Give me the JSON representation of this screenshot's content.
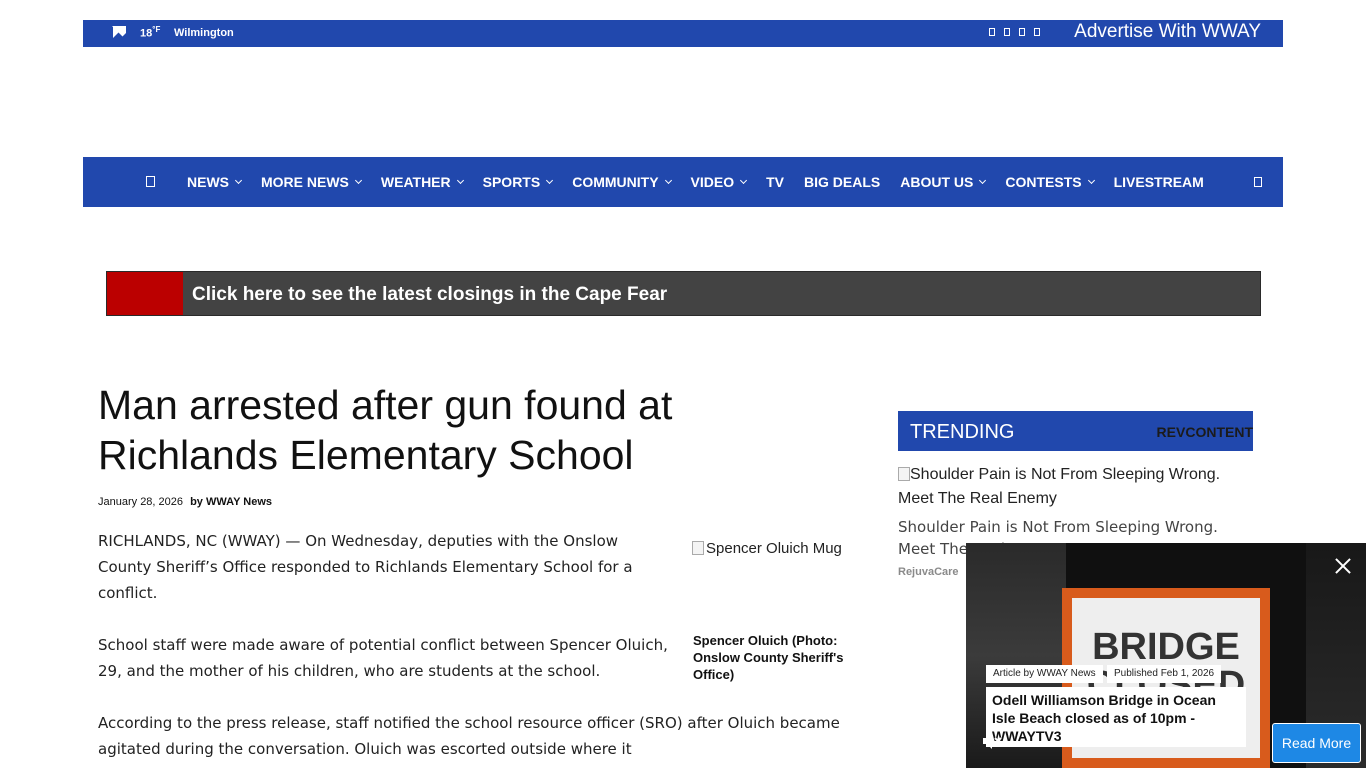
{
  "topbar": {
    "temperature": "18",
    "temp_unit": "°F",
    "city": "Wilmington",
    "advertise_label": "Advertise With WWAY",
    "social_icons": [
      "facebook-icon",
      "twitter-icon",
      "instagram-icon",
      "youtube-icon"
    ]
  },
  "nav": {
    "items": [
      {
        "label": "NEWS",
        "dropdown": true
      },
      {
        "label": "MORE NEWS",
        "dropdown": true
      },
      {
        "label": "WEATHER",
        "dropdown": true
      },
      {
        "label": "SPORTS",
        "dropdown": true
      },
      {
        "label": "COMMUNITY",
        "dropdown": true
      },
      {
        "label": "VIDEO",
        "dropdown": true
      },
      {
        "label": "TV",
        "dropdown": false
      },
      {
        "label": "BIG DEALS",
        "dropdown": false
      },
      {
        "label": "ABOUT US",
        "dropdown": true
      },
      {
        "label": "CONTESTS",
        "dropdown": true
      },
      {
        "label": "LIVESTREAM",
        "dropdown": false
      }
    ]
  },
  "closings": {
    "text": "Click here to see the latest closings in the Cape Fear"
  },
  "article": {
    "headline": "Man arrested after gun found at Richlands Elementary School",
    "date": "January 28, 2026",
    "byline": "by WWAY News",
    "paragraphs": [
      "RICHLANDS, NC (WWAY) — On Wednesday, deputies with the Onslow County Sheriff’s Office responded to Richlands Elementary School for a conflict.",
      "School staff were made aware of potential conflict between Spencer Oluich, 29, and the mother of his children, who are students at the school.",
      "According to the press release, staff notified the school resource officer (SRO) after Oluich became agitated during the conversation. Oluich was escorted outside where it"
    ],
    "image_alt": "Spencer Oluich Mug",
    "image_caption": "Spencer Oluich (Photo: Onslow County Sheriff's Office)"
  },
  "trending": {
    "label": "TRENDING",
    "provider": "REVCONTENT",
    "item": {
      "image_alt": "Shoulder Pain is Not From Sleeping Wrong. Meet The Real Enemy",
      "title": "Shoulder Pain is Not From Sleeping Wrong. Meet The Real Enemy",
      "source": "RejuvaCare"
    }
  },
  "video": {
    "sign_line1": "BRIDGE",
    "sign_line2": "CLOSED",
    "author_tag": "Article by WWAY News",
    "published_tag": "Published Feb 1, 2026",
    "title": "Odell Williamson Bridge in Ocean Isle Beach closed as of 10pm - WWAYTV3",
    "read_more": "Read More"
  },
  "colors": {
    "brand_blue": "#2148ad",
    "closings_red": "#bb0000",
    "closings_bg": "#434343",
    "read_more_blue": "#1e88e5"
  }
}
